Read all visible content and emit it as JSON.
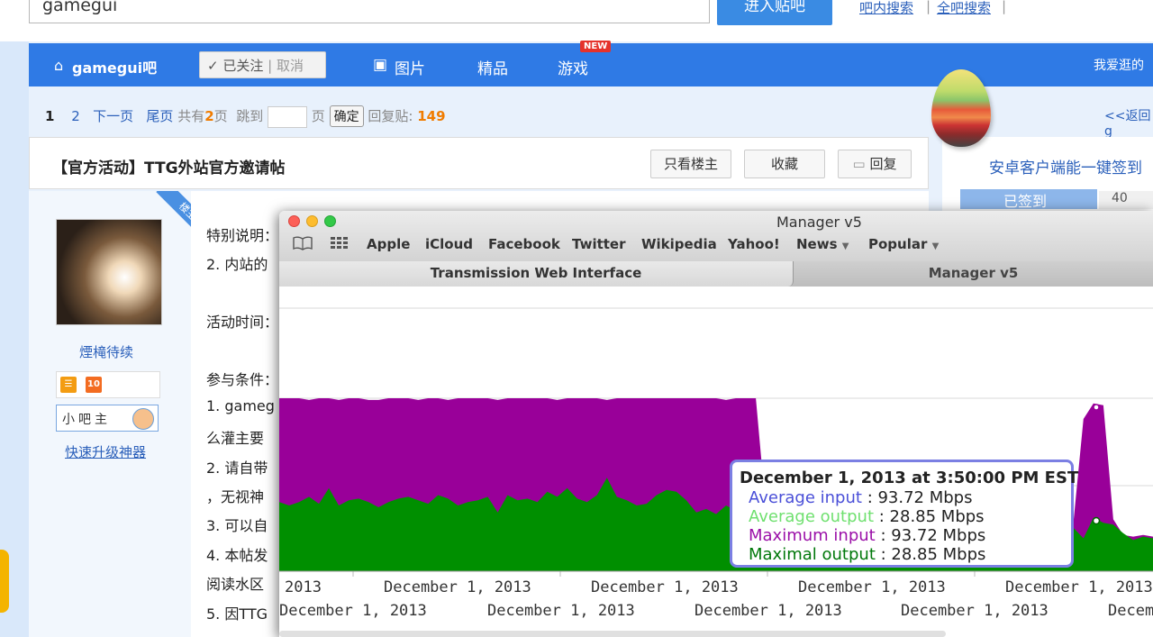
{
  "search": {
    "value": "gamegui",
    "enter_label": "进入贴吧",
    "link_search_in_bar": "吧内搜索",
    "link_search_all": "全吧搜索",
    "separator": "|"
  },
  "nav": {
    "forum_name": "gamegui吧",
    "follow_label": "已关注",
    "cancel_label": "取消",
    "items": [
      "图片",
      "精品",
      "游戏"
    ],
    "new_badge": "NEW",
    "right_text": "我爱逛的"
  },
  "pager": {
    "current": "1",
    "page2": "2",
    "next": "下一页",
    "last": "尾页",
    "total_prefix": "共有",
    "total_pages": "2",
    "total_suffix": "页",
    "jump": "跳到",
    "page_unit": "页",
    "confirm": "确定",
    "replies_label": "回复贴:",
    "replies": "149",
    "back": "<<返回g"
  },
  "post": {
    "title": "【官方活动】TTG外站官方邀请帖",
    "only_owner": "只看楼主",
    "favorite": "收藏",
    "reply": "回复",
    "owner_tag": "楼主",
    "author": "煙槞待续",
    "level_num": "10",
    "role": "小吧主",
    "upgrade": "快速升级神器",
    "lines": [
      "特别说明：",
      "2. 内站的",
      "活动时间：",
      "参与条件：",
      "1. gameg",
      "么灌主要",
      "2. 请自带",
      "，无视神",
      "3. 可以自",
      "4. 本帖发",
      "阅读水区",
      "5. 因TTG"
    ]
  },
  "sidebar": {
    "app_signin": "安卓客户端能一键签到",
    "signed": "已签到",
    "count": "40"
  },
  "window": {
    "title": "Manager v5",
    "bookmarks": [
      "Apple",
      "iCloud",
      "Facebook",
      "Twitter",
      "Wikipedia",
      "Yahoo!",
      "News",
      "Popular"
    ],
    "tabs": [
      "Transmission Web Interface",
      "Manager v5"
    ]
  },
  "tooltip": {
    "title": "December 1, 2013 at 3:50:00 PM EST",
    "rows": [
      {
        "label": "Average input",
        "value": ": 93.72 Mbps",
        "color": "#4a4fd8"
      },
      {
        "label": "Average output",
        "value": ": 28.85 Mbps",
        "color": "#6fe06f"
      },
      {
        "label": "Maximum input",
        "value": ": 93.72 Mbps",
        "color": "#9b10a8"
      },
      {
        "label": "Maximal output",
        "value": ": 28.85 Mbps",
        "color": "#00780a"
      }
    ]
  },
  "chart_data": {
    "type": "area",
    "colors": {
      "input": "#990099",
      "output": "#008f00",
      "grid": "#d8d8d8",
      "tooltip_border": "#7b7fe3"
    },
    "x_tick_labels_row1": [
      "2013",
      "December 1, 2013",
      "December 1, 2013",
      "December 1, 2013",
      "December 1, 2013"
    ],
    "x_tick_labels_row2": [
      "December 1, 2013",
      "December 1, 2013",
      "December 1, 2013",
      "December 1, 2013",
      "Decem"
    ],
    "series": [
      {
        "name": "Maximum input",
        "color": "#990099",
        "values": [
          100,
          100,
          100,
          99,
          100,
          100,
          99,
          100,
          100,
          99,
          99,
          100,
          100,
          100,
          99,
          100,
          100,
          99,
          100,
          100,
          100,
          100,
          99,
          100,
          100,
          100,
          100,
          100,
          99,
          100,
          100,
          100,
          100,
          99,
          100,
          100,
          100,
          100,
          100,
          100,
          100,
          100,
          100,
          100,
          100,
          99,
          100,
          100,
          100,
          36,
          34,
          30,
          31,
          36,
          34,
          30,
          31,
          29,
          30,
          31,
          28,
          30,
          27,
          28,
          29,
          27,
          29,
          27,
          28,
          27,
          26,
          28,
          27,
          27,
          26,
          27,
          26,
          27,
          29,
          26,
          29,
          88,
          97,
          96,
          30,
          21,
          20,
          21,
          20
        ]
      },
      {
        "name": "Maximal output",
        "color": "#008f00",
        "values": [
          40,
          38,
          40,
          43,
          39,
          48,
          38,
          41,
          42,
          40,
          37,
          40,
          42,
          43,
          41,
          39,
          44,
          42,
          38,
          40,
          41,
          43,
          34,
          44,
          41,
          42,
          40,
          46,
          43,
          48,
          42,
          40,
          44,
          54,
          43,
          41,
          38,
          39,
          44,
          47,
          46,
          41,
          34,
          36,
          33,
          38,
          35,
          37,
          38,
          8,
          16,
          30,
          32,
          37,
          27,
          23,
          25,
          22,
          23,
          22,
          20,
          23,
          20,
          21,
          22,
          20,
          22,
          21,
          22,
          28,
          22,
          21,
          22,
          20,
          21,
          20,
          22,
          21,
          23,
          20,
          25,
          19,
          31,
          28,
          27,
          22,
          18,
          20,
          19
        ]
      }
    ]
  }
}
